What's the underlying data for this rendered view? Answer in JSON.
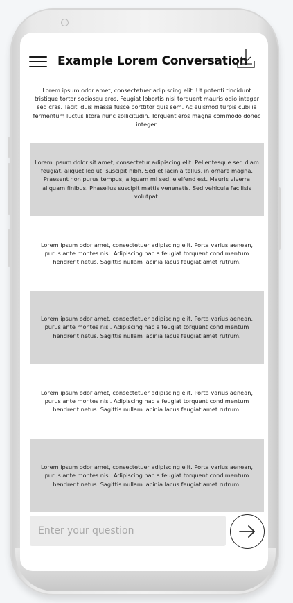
{
  "header": {
    "title": "Example Lorem Conversation",
    "menu_icon": "hamburger-menu-icon",
    "download_icon": "download-icon"
  },
  "messages": [
    {
      "style": "plain",
      "text": "Lorem ipsum odor amet, consectetuer adipiscing elit. Ut potenti tincidunt tristique tortor sociosqu eros. Feugiat lobortis nisi torquent mauris odio integer sed cras. Taciti duis massa fusce porttitor quis sem. Ac euismod turpis cubilia fermentum luctus litora nunc sollicitudin. Torquent eros magna commodo donec integer."
    },
    {
      "style": "grey",
      "text": "Lorem ipsum dolor sit amet, consectetur adipiscing elit. Pellentesque sed diam feugiat, aliquet leo ut, suscipit nibh. Sed et lacinia tellus, in ornare magna. Praesent non purus tempus, aliquam mi sed, eleifend est. Mauris viverra aliquam finibus. Phasellus suscipit mattis venenatis. Sed vehicula facilisis volutpat."
    },
    {
      "style": "plain",
      "text": "Lorem ipsum odor amet, consectetuer adipiscing elit. Porta varius aenean, purus ante montes nisi. Adipiscing hac a feugiat torquent condimentum hendrerit netus. Sagittis nullam lacinia lacus feugiat amet rutrum."
    },
    {
      "style": "grey",
      "text": "Lorem ipsum odor amet, consectetuer adipiscing elit. Porta varius aenean, purus ante montes nisi. Adipiscing hac a feugiat torquent condimentum hendrerit netus. Sagittis nullam lacinia lacus feugiat amet rutrum."
    },
    {
      "style": "plain",
      "text": "Lorem ipsum odor amet, consectetuer adipiscing elit. Porta varius aenean, purus ante montes nisi. Adipiscing hac a feugiat torquent condimentum hendrerit netus. Sagittis nullam lacinia lacus feugiat amet rutrum."
    },
    {
      "style": "grey",
      "text": "Lorem ipsum odor amet, consectetuer adipiscing elit. Porta varius aenean, purus ante montes nisi. Adipiscing hac a feugiat torquent condimentum hendrerit netus. Sagittis nullam lacinia lacus feugiat amet rutrum."
    }
  ],
  "composer": {
    "placeholder": "Enter your question",
    "value": "",
    "send_icon": "arrow-right-circle-icon"
  }
}
